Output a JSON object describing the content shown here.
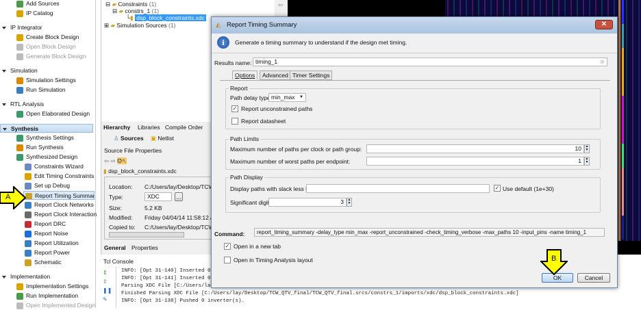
{
  "flow_navigator": {
    "items": [
      {
        "label": "Add Sources",
        "type": "item",
        "disabled": false
      },
      {
        "label": "IP Catalog",
        "type": "item",
        "disabled": false
      },
      {
        "label": "IP Integrator",
        "type": "section"
      },
      {
        "label": "Create Block Design",
        "type": "item",
        "disabled": false
      },
      {
        "label": "Open Block Design",
        "type": "item",
        "disabled": true
      },
      {
        "label": "Generate Block Design",
        "type": "item",
        "disabled": true
      },
      {
        "label": "Simulation",
        "type": "section"
      },
      {
        "label": "Simulation Settings",
        "type": "item",
        "disabled": false
      },
      {
        "label": "Run Simulation",
        "type": "item",
        "disabled": false
      },
      {
        "label": "RTL Analysis",
        "type": "section"
      },
      {
        "label": "Open Elaborated Design",
        "type": "item",
        "disabled": false
      },
      {
        "label": "Synthesis",
        "type": "section-selected"
      },
      {
        "label": "Synthesis Settings",
        "type": "item",
        "disabled": false
      },
      {
        "label": "Run Synthesis",
        "type": "item",
        "disabled": false
      },
      {
        "label": "Synthesized Design",
        "type": "item",
        "disabled": false
      },
      {
        "label": "Constraints Wizard",
        "type": "sub",
        "disabled": false
      },
      {
        "label": "Edit Timing Constraints",
        "type": "sub",
        "disabled": false
      },
      {
        "label": "Set up Debug",
        "type": "sub",
        "disabled": false
      },
      {
        "label": "Report Timing Summary",
        "type": "sub-selected",
        "disabled": false
      },
      {
        "label": "Report Clock Networks",
        "type": "sub",
        "disabled": false
      },
      {
        "label": "Report Clock Interaction",
        "type": "sub",
        "disabled": false
      },
      {
        "label": "Report DRC",
        "type": "sub",
        "disabled": false
      },
      {
        "label": "Report Noise",
        "type": "sub",
        "disabled": false
      },
      {
        "label": "Report Utilization",
        "type": "sub",
        "disabled": false
      },
      {
        "label": "Report Power",
        "type": "sub",
        "disabled": false
      },
      {
        "label": "Schematic",
        "type": "sub",
        "disabled": false
      },
      {
        "label": "Implementation",
        "type": "section"
      },
      {
        "label": "Implementation Settings",
        "type": "item",
        "disabled": false
      },
      {
        "label": "Run Implementation",
        "type": "item",
        "disabled": false
      },
      {
        "label": "Open Implemented Design",
        "type": "item",
        "disabled": true
      }
    ],
    "callout_a": "A"
  },
  "sources": {
    "tree": [
      {
        "label": "Constraints",
        "count": "(1)"
      },
      {
        "label": "constrs_1",
        "count": "(1)"
      },
      {
        "label": "dsp_block_constraints.xdc",
        "count": ""
      },
      {
        "label": "Simulation Sources",
        "count": "(1)"
      }
    ],
    "tabs": [
      "Hierarchy",
      "Libraries",
      "Compile Order"
    ],
    "view_tabs": [
      "Sources",
      "Netlist"
    ]
  },
  "properties": {
    "title": "Source File Properties",
    "file": "dsp_block_constraints.xdc",
    "rows": [
      {
        "label": "Location:",
        "value": "C:/Users/lay/Desktop/TCW"
      },
      {
        "label": "Type:",
        "value": "XDC"
      },
      {
        "label": "Size:",
        "value": "5.2 KB"
      },
      {
        "label": "Modified:",
        "value": "Friday 04/04/14 11:58:12 A"
      },
      {
        "label": "Copied to:",
        "value": "C:/Users/lay/Desktop/TCW"
      }
    ],
    "browse_label": "...",
    "tabs": [
      "General",
      "Properties"
    ]
  },
  "console": {
    "title": "Tcl Console",
    "lines": [
      "INFO: [Opt 31-140] Inserted 0",
      "INFO: [Opt 31-141] Inserted 0",
      "Parsing XDC File [C:/Users/la",
      "Finished Parsing XDC File [C:/Users/lay/Desktop/TCW_QTV_final/TCW_QTV_final.srcs/constrs_1/imports/xdc/dsp_block_constraints.xdc]",
      "INFO: [Opt 31-138] Pushed 0 inverter(s)."
    ]
  },
  "dialog": {
    "title": "Report Timing Summary",
    "close_label": "✕",
    "info": "Generate a timing summary to understand if the design met timing.",
    "results_name_label": "Results name:",
    "results_name": "timing_1",
    "tabs": [
      "Options",
      "Advanced",
      "Timer Settings"
    ],
    "report": {
      "legend": "Report",
      "path_delay_label": "Path delay type:",
      "path_delay_value": "min_max",
      "unconstrained_label": "Report unconstrained paths",
      "unconstrained_checked": true,
      "datasheet_label": "Report datasheet",
      "datasheet_checked": false
    },
    "path_limits": {
      "legend": "Path Limits",
      "max_paths_label": "Maximum number of paths per clock or path group:",
      "max_paths": "10",
      "worst_label": "Maximum number of worst paths per endpoint:",
      "worst": "1"
    },
    "path_display": {
      "legend": "Path Display",
      "slack_label": "Display paths with slack less than:",
      "slack_value": "",
      "use_default_label": "Use default (1e+30)",
      "use_default_checked": true,
      "digits_label": "Significant digits:",
      "digits": "3"
    },
    "command_label": "Command:",
    "command": "report_timing_summary -delay_type min_max -report_unconstrained -check_timing_verbose -max_paths 10 -input_pins -name timing_1",
    "open_new_tab_label": "Open in a new tab",
    "open_new_tab_checked": true,
    "timing_layout_label": "Open in Timing Analysis layout",
    "timing_layout_checked": false,
    "ok_label": "OK",
    "cancel_label": "Cancel",
    "callout_b": "B"
  },
  "colors": {
    "selection": "#3399ff",
    "callout": "#ffff00",
    "title_bar": "#b9cfe8",
    "device_bg": "#0a0a40"
  }
}
